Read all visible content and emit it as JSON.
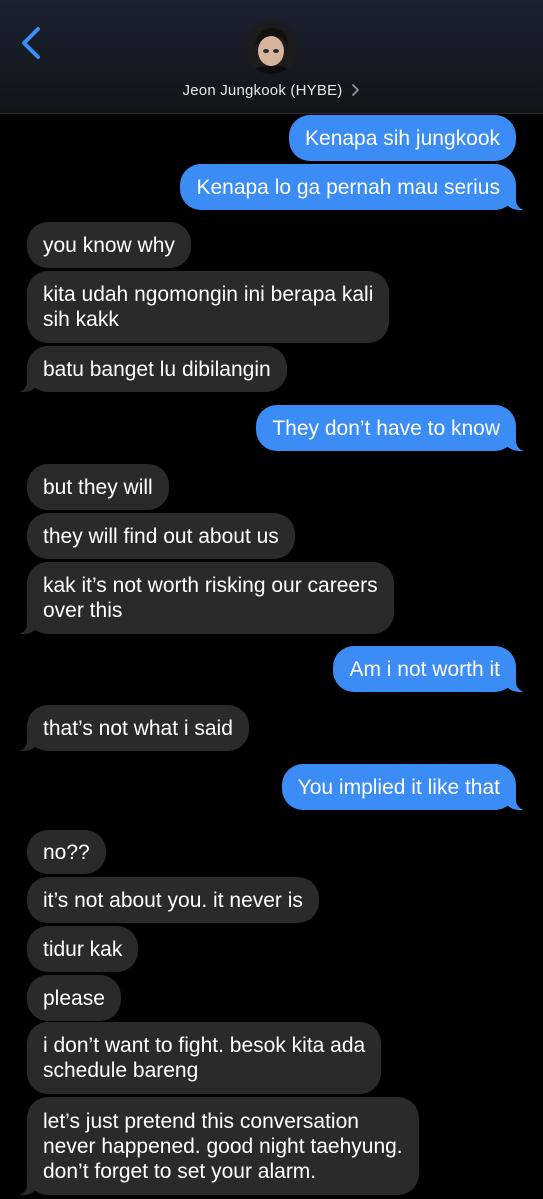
{
  "header": {
    "contact_name": "Jeon Jungkook (HYBE)",
    "back_icon": "chevron-left-icon",
    "detail_icon": "chevron-right-icon",
    "accent_color": "#3b8cf5"
  },
  "messages": [
    {
      "from": "me",
      "text": "Kenapa sih jungkook"
    },
    {
      "from": "me",
      "text": "Kenapa lo ga pernah mau serius"
    },
    {
      "from": "them",
      "text": "you know why"
    },
    {
      "from": "them",
      "text": "kita udah ngomongin ini berapa kali\nsih kakk"
    },
    {
      "from": "them",
      "text": "batu banget lu dibilangin"
    },
    {
      "from": "me",
      "text": "They don’t have to know"
    },
    {
      "from": "them",
      "text": "but they will"
    },
    {
      "from": "them",
      "text": "they will find out about us"
    },
    {
      "from": "them",
      "text": "kak it’s not worth risking our careers\nover this"
    },
    {
      "from": "me",
      "text": "Am i not worth it"
    },
    {
      "from": "them",
      "text": "that’s not what i said"
    },
    {
      "from": "me",
      "text": "You implied it like that"
    },
    {
      "from": "them",
      "text": "no??"
    },
    {
      "from": "them",
      "text": "it’s not about you. it never is"
    },
    {
      "from": "them",
      "text": "tidur kak"
    },
    {
      "from": "them",
      "text": "please"
    },
    {
      "from": "them",
      "text": "i don’t want to fight. besok kita ada\nschedule bareng"
    },
    {
      "from": "them",
      "text": "let’s just pretend this conversation\nnever happened. good night taehyung.\ndon’t forget to set your alarm."
    }
  ]
}
